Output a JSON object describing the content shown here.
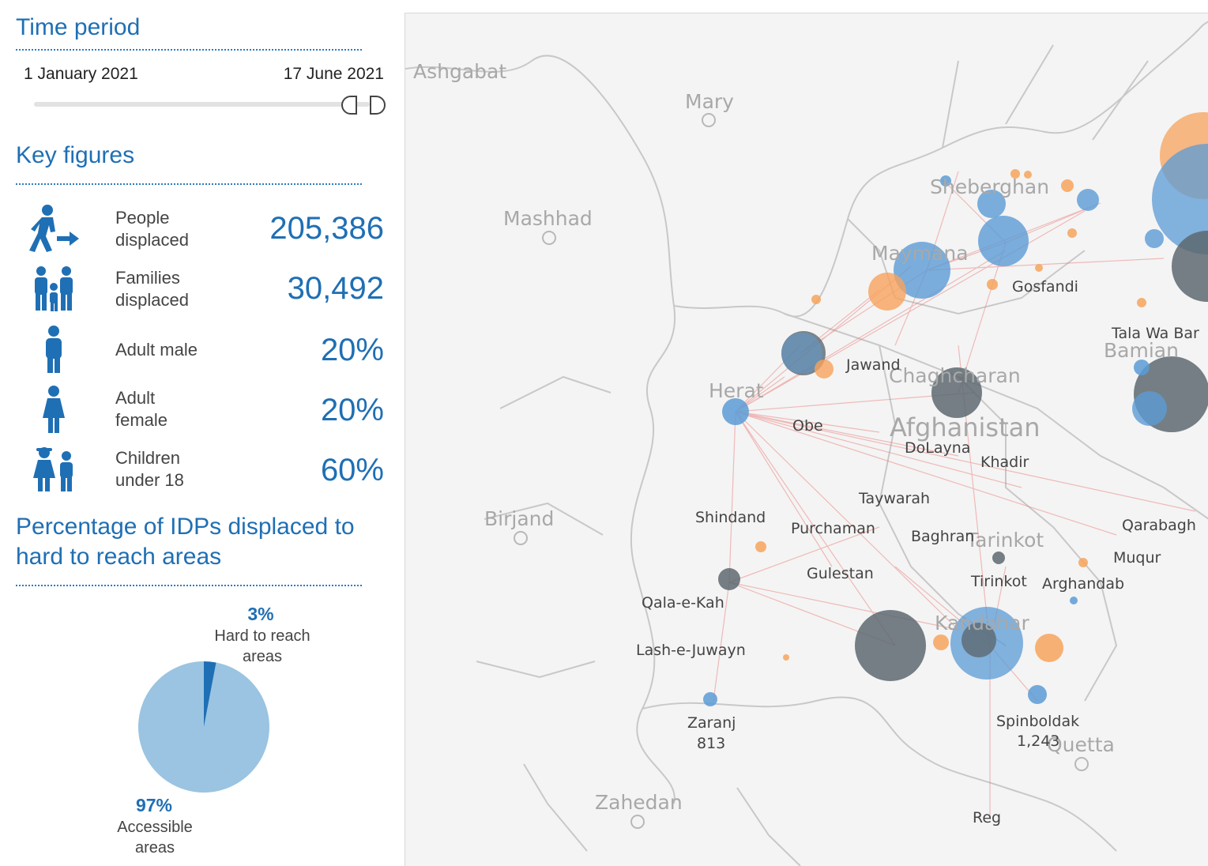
{
  "time_period": {
    "title": "Time period",
    "start_label": "1 January 2021",
    "end_label": "17 June 2021"
  },
  "key_figures": {
    "title": "Key figures",
    "items": [
      {
        "label_line1": "People",
        "label_line2": "displaced",
        "value": "205,386",
        "icon": "person-moving-icon"
      },
      {
        "label_line1": "Families",
        "label_line2": "displaced",
        "value": "30,492",
        "icon": "family-icon"
      },
      {
        "label_line1": "Adult male",
        "label_line2": "",
        "value": "20%",
        "icon": "man-icon"
      },
      {
        "label_line1": "Adult",
        "label_line2": "female",
        "value": "20%",
        "icon": "woman-icon"
      },
      {
        "label_line1": "Children",
        "label_line2": "under 18",
        "value": "60%",
        "icon": "children-icon"
      }
    ]
  },
  "pie_section": {
    "title_line1": "Percentage of IDPs displaced to",
    "title_line2": "hard to reach areas",
    "hard_pct": "3%",
    "hard_label_line1": "Hard to reach",
    "hard_label_line2": "areas",
    "accessible_pct": "97%",
    "accessible_label_line1": "Accessible",
    "accessible_label_line2": "areas",
    "hard_fraction": 0.03,
    "accessible_fraction": 0.97,
    "colors": {
      "hard": "#1f6fb4",
      "accessible": "#9ac4e1"
    }
  },
  "map": {
    "colors": {
      "blue": "#5b9bd5",
      "gray": "#5d6970",
      "orange": "#f7a35c",
      "flow": "#e8726f",
      "background": "#f4f4f4",
      "border": "#c8c8c8"
    },
    "country_label": "Afghanistan",
    "city_labels": [
      "Ashgabat",
      "Mary",
      "Mashhad",
      "Birjand",
      "Zahedan",
      "Quetta",
      "Sheberghan",
      "Maymana",
      "Herat",
      "Chaghcharan",
      "Bamian",
      "Tarinkot",
      "Kandahar"
    ],
    "district_labels": [
      "Gosfandi",
      "Tala Wa Bar",
      "Jawand",
      "Obe",
      "DoLayna",
      "Khadir",
      "Taywarah",
      "Shindand",
      "Purchaman",
      "Baghran",
      "Qarabagh",
      "Muqur",
      "Gulestan",
      "Tirinkot",
      "Arghandab",
      "Qala-e-Kah",
      "Lash-e-Juwayn",
      "Zaranj",
      "Spinboldak",
      "Reg"
    ],
    "value_labels": [
      "813",
      "1,243"
    ]
  }
}
